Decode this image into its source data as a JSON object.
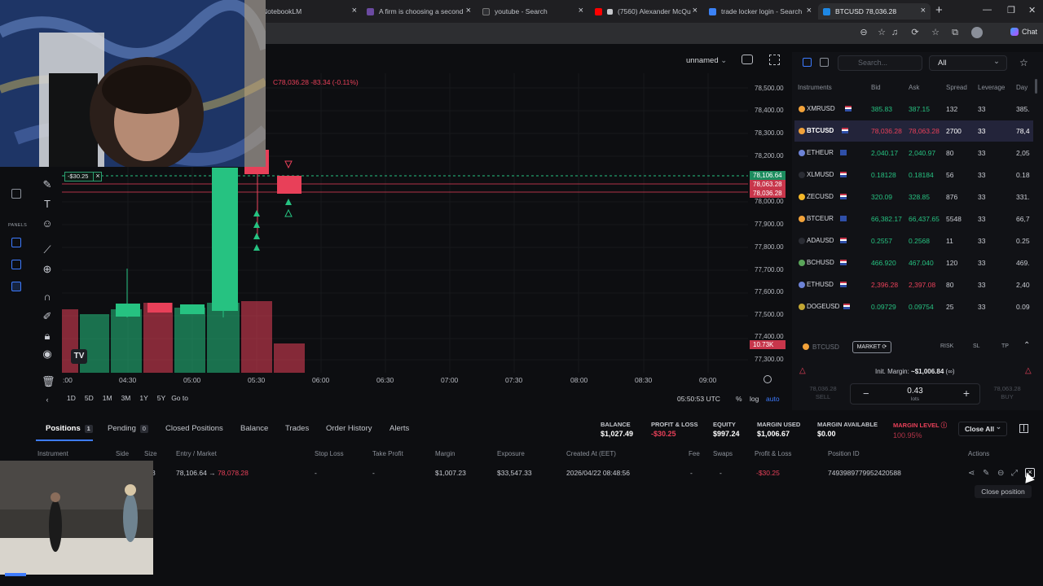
{
  "browser": {
    "tabs": [
      {
        "title": "NotebookLM",
        "color": "#5f6368"
      },
      {
        "title": "A firm is choosing a second",
        "color": "#8e44ad"
      },
      {
        "title": "youtube - Search",
        "color": "#3b82f6"
      },
      {
        "title": "(7560) Alexander McQu",
        "color": "#ff0000"
      },
      {
        "title": "trade locker login - Search",
        "color": "#3b82f6"
      },
      {
        "title": "BTCUSD 78,036.28",
        "color": "#1e88e5"
      }
    ],
    "copilot_label": "Chat"
  },
  "chart": {
    "layout_name": "unnamed",
    "ohlc_close": "C78,036.28 -83.34 (-0.11%)",
    "price_labels": [
      "78,500.00",
      "78,400.00",
      "78,300.00",
      "78,200.00",
      "78,000.00",
      "77,900.00",
      "77,800.00",
      "77,700.00",
      "77,600.00",
      "77,500.00",
      "77,400.00",
      "77,300.00"
    ],
    "price_tags": {
      "entry": "78,106.64",
      "ask": "78,063.28",
      "bid": "78,036.28",
      "volume": "10.73K"
    },
    "time_labels": [
      ":00",
      "04:30",
      "05:00",
      "05:30",
      "06:00",
      "06:30",
      "07:00",
      "07:30",
      "08:00",
      "08:30",
      "09:00"
    ],
    "ranges": [
      "1D",
      "5D",
      "1M",
      "3M",
      "1Y",
      "5Y",
      "Go to"
    ],
    "clock": "05:50:53 UTC",
    "pct": "%",
    "log": "log",
    "auto": "auto",
    "position_pl_tag": "-$30.25",
    "tv_logo": "TV",
    "panels_label": "PANELS"
  },
  "instruments": {
    "search_placeholder": "Search...",
    "filter": "All",
    "headers": [
      "Instruments",
      "Bid",
      "Ask",
      "Spread",
      "Leverage",
      "Day"
    ],
    "rows": [
      {
        "sym": "XMRUSD",
        "bid": "385.83",
        "ask": "387.15",
        "spread": "132",
        "lev": "33",
        "day": "385.",
        "red": false
      },
      {
        "sym": "BTCUSD",
        "bid": "78,036.28",
        "ask": "78,063.28",
        "spread": "2700",
        "lev": "33",
        "day": "78,4",
        "red": true
      },
      {
        "sym": "ETHEUR",
        "bid": "2,040.17",
        "ask": "2,040.97",
        "spread": "80",
        "lev": "33",
        "day": "2,05",
        "red": false
      },
      {
        "sym": "XLMUSD",
        "bid": "0.18128",
        "ask": "0.18184",
        "spread": "56",
        "lev": "33",
        "day": "0.18",
        "red": false
      },
      {
        "sym": "ZECUSD",
        "bid": "320.09",
        "ask": "328.85",
        "spread": "876",
        "lev": "33",
        "day": "331.",
        "red": false
      },
      {
        "sym": "BTCEUR",
        "bid": "66,382.17",
        "ask": "66,437.65",
        "spread": "5548",
        "lev": "33",
        "day": "66,7",
        "red": false
      },
      {
        "sym": "ADAUSD",
        "bid": "0.2557",
        "ask": "0.2568",
        "spread": "11",
        "lev": "33",
        "day": "0.25",
        "red": false
      },
      {
        "sym": "BCHUSD",
        "bid": "466.920",
        "ask": "467.040",
        "spread": "120",
        "lev": "33",
        "day": "469.",
        "red": false
      },
      {
        "sym": "ETHUSD",
        "bid": "2,396.28",
        "ask": "2,397.08",
        "spread": "80",
        "lev": "33",
        "day": "2,40",
        "red": true
      },
      {
        "sym": "DOGEUSD",
        "bid": "0.09729",
        "ask": "0.09754",
        "spread": "25",
        "lev": "33",
        "day": "0.09",
        "red": false
      }
    ]
  },
  "order": {
    "symbol": "BTCUSD",
    "type": "MARKET",
    "labels": [
      "RISK",
      "SL",
      "TP"
    ],
    "margin_label": "Init. Margin:",
    "margin_value": "~$1,006.84",
    "margin_suffix": "(∞)",
    "sell_price": "78,036.28",
    "buy_price": "78,063.28",
    "sell_label": "SELL",
    "buy_label": "BUY",
    "lots": "0.43",
    "lots_unit": "lots"
  },
  "bottom": {
    "tabs": [
      {
        "label": "Positions",
        "count": "1"
      },
      {
        "label": "Pending",
        "count": "0"
      },
      {
        "label": "Closed Positions"
      },
      {
        "label": "Balance"
      },
      {
        "label": "Trades"
      },
      {
        "label": "Order History"
      },
      {
        "label": "Alerts"
      }
    ],
    "stats": [
      {
        "label": "BALANCE",
        "value": "$1,027.49"
      },
      {
        "label": "PROFIT & LOSS",
        "value": "-$30.25"
      },
      {
        "label": "EQUITY",
        "value": "$997.24"
      },
      {
        "label": "MARGIN USED",
        "value": "$1,006.67"
      },
      {
        "label": "MARGIN AVAILABLE",
        "value": "$0.00"
      },
      {
        "label": "MARGIN LEVEL",
        "value": "100.95%"
      }
    ],
    "close_all": "Close All",
    "headers": [
      "Instrument",
      "Side",
      "Size",
      "Entry / Market",
      "Stop Loss",
      "Take Profit",
      "Margin",
      "Exposure",
      "Created At (EET)",
      "Fee",
      "Swaps",
      "Profit & Loss",
      "Position ID",
      "Actions"
    ],
    "row": {
      "size": "3",
      "entry": "78,106.64",
      "market": "78,078.28",
      "sl": "-",
      "tp": "-",
      "margin": "$1,007.23",
      "exposure": "$33,547.33",
      "created": "2026/04/22 08:48:56",
      "fee": "-",
      "swaps": "-",
      "pnl": "-$30.25",
      "id": "7493989779952420588"
    },
    "tooltip": "Close position"
  },
  "colors": {
    "green": "#26c281",
    "red": "#e84059",
    "accent": "#3d7bff"
  }
}
